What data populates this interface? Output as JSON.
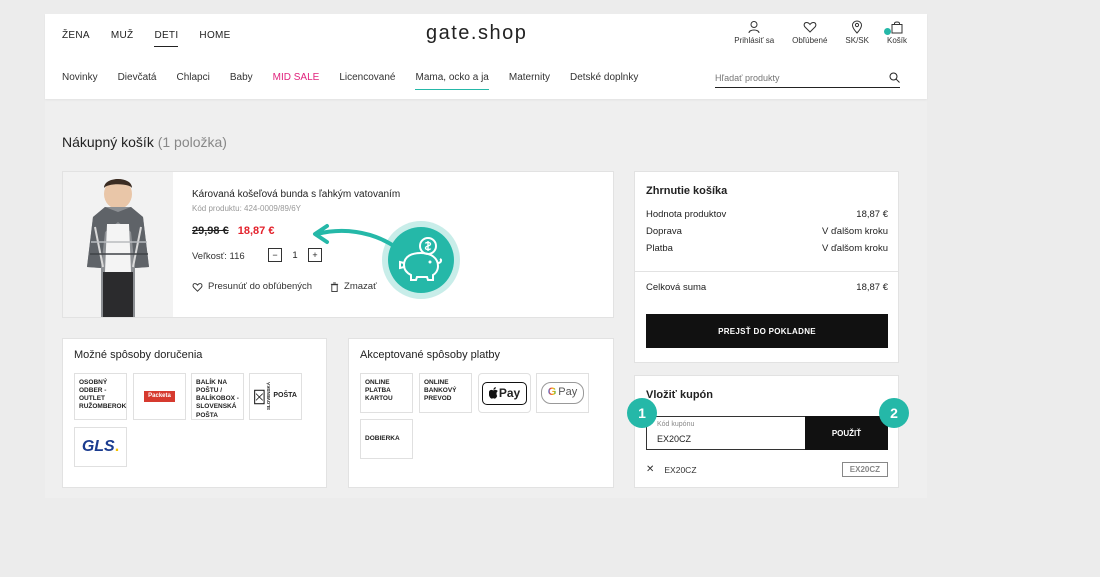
{
  "header": {
    "logo": "gate.shop",
    "top_nav": [
      "ŽENA",
      "MUŽ",
      "DETI",
      "HOME"
    ],
    "active_top": "DETI",
    "icons": [
      {
        "name": "user-icon",
        "label": "Prihlásiť sa"
      },
      {
        "name": "heart-icon",
        "label": "Obľúbené"
      },
      {
        "name": "location-icon",
        "label": "SK/SK"
      },
      {
        "name": "bag-icon",
        "label": "Košík"
      }
    ],
    "categories": [
      "Novinky",
      "Dievčatá",
      "Chlapci",
      "Baby",
      "MID SALE",
      "Licencované",
      "Mama, ocko a ja",
      "Maternity",
      "Detské doplnky"
    ],
    "search_placeholder": "Hľadať produkty"
  },
  "cart": {
    "title": "Nákupný košík",
    "count": "(1 položka)"
  },
  "product": {
    "name": "Károvaná košeľová bunda s ľahkým vatovaním",
    "code": "Kód produktu: 424-0009/89/6Y",
    "old_price": "29,98 €",
    "new_price": "18,87 €",
    "size_label": "Veľkosť: 116",
    "qty_minus": "−",
    "qty_value": "1",
    "qty_plus": "+",
    "move_to_fav": "Presunúť do obľúbených",
    "remove": "Zmazať"
  },
  "delivery": {
    "title": "Možné spôsoby doručenia",
    "options": [
      "OSOBNÝ ODBER - OUTLET RUŽOMBEROK",
      "BALÍK NA POŠTU / BALÍKOBOX - SLOVENSKÁ POŠTA"
    ],
    "logo_packeta": "Packeta",
    "logo_posta": "POŠTA",
    "logo_posta_side": "Slovenská",
    "logo_gls": "GLS"
  },
  "payment": {
    "title": "Akceptované spôsoby platby",
    "options": [
      "ONLINE PLATBA KARTOU",
      "ONLINE BANKOVÝ PREVOD",
      "DOBIERKA"
    ],
    "apple_pay": "Pay",
    "google_pay": "Pay"
  },
  "summary": {
    "title": "Zhrnutie košíka",
    "rows": [
      {
        "label": "Hodnota produktov",
        "value": "18,87 €"
      },
      {
        "label": "Doprava",
        "value": "V ďalšom kroku"
      },
      {
        "label": "Platba",
        "value": "V ďalšom kroku"
      }
    ],
    "total_label": "Celková suma",
    "total_value": "18,87 €",
    "checkout": "PREJSŤ DO POKLADNE"
  },
  "coupon": {
    "title": "Vložiť kupón",
    "field_label": "Kód kupónu",
    "field_value": "EX20CZ",
    "apply": "POUŽIŤ",
    "applied_code": "EX20CZ",
    "applied_tag": "EX20CZ"
  },
  "markers": [
    "1",
    "2"
  ],
  "colors": {
    "accent": "#25b8a8",
    "sale": "#e0227c",
    "price_red": "#e3212b"
  }
}
